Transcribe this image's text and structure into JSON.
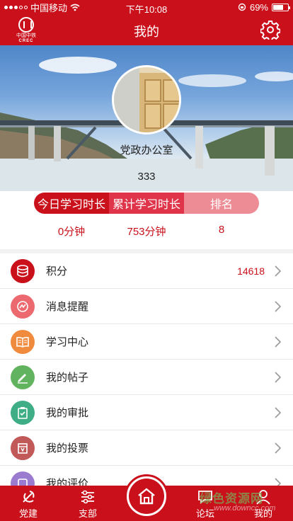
{
  "status_bar": {
    "carrier": "中国移动",
    "time": "下午10:08",
    "battery_percent": "69%",
    "battery_level": 0.69
  },
  "nav": {
    "logo_cn": "中国中铁",
    "logo_en": "CREC",
    "title": "我的",
    "settings_icon": "gear-icon"
  },
  "profile": {
    "name": "党政办公室",
    "id": "333"
  },
  "stats": {
    "tabs": [
      "今日学习时长",
      "累计学习时长",
      "排名"
    ],
    "values": [
      "0分钟",
      "753分钟",
      "8"
    ]
  },
  "menu": [
    {
      "label": "积分",
      "value": "14618",
      "icon": "points-coins-icon",
      "color": "#c9101b"
    },
    {
      "label": "消息提醒",
      "value": "",
      "icon": "message-reminder-icon",
      "color": "#ec6a6f"
    },
    {
      "label": "学习中心",
      "value": "",
      "icon": "book-icon",
      "color": "#f08a3c"
    },
    {
      "label": "我的帖子",
      "value": "",
      "icon": "pencil-icon",
      "color": "#62b360"
    },
    {
      "label": "我的审批",
      "value": "",
      "icon": "clipboard-check-icon",
      "color": "#3fae86"
    },
    {
      "label": "我的投票",
      "value": "",
      "icon": "vote-icon",
      "color": "#c05958"
    },
    {
      "label": "我的评价",
      "value": "",
      "icon": "evaluation-icon",
      "color": "#9b7bd0"
    }
  ],
  "tabbar": {
    "items": [
      {
        "label": "党建",
        "icon": "party-emblem-icon"
      },
      {
        "label": "支部",
        "icon": "sliders-icon"
      },
      {
        "label": "论坛",
        "icon": "chat-bubble-icon"
      },
      {
        "label": "我的",
        "icon": "person-icon"
      }
    ],
    "home_icon": "home-icon"
  },
  "watermark": {
    "cn": "绿色资源网",
    "en": "www.downcc.com"
  }
}
